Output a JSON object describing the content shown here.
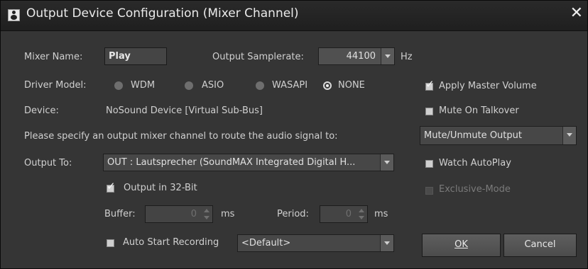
{
  "window": {
    "title": "Output Device Configuration (Mixer Channel)",
    "close_icon": "close-x-icon"
  },
  "mixer_name": {
    "label": "Mixer Name:",
    "value": "Play"
  },
  "samplerate": {
    "label": "Output Samplerate:",
    "value": "44100",
    "unit": "Hz"
  },
  "driver_model": {
    "label": "Driver Model:",
    "options": [
      "WDM",
      "ASIO",
      "WASAPI",
      "NONE"
    ],
    "selected": "NONE"
  },
  "device": {
    "label": "Device:",
    "value": "NoSound Device [Virtual Sub-Bus]"
  },
  "route_prompt": "Please specify an output mixer channel to route the audio signal to:",
  "output_to": {
    "label": "Output To:",
    "value": "OUT  : Lautsprecher (SoundMAX Integrated Digital H..."
  },
  "output_32bit": {
    "label": "Output in 32-Bit",
    "checked": true
  },
  "buffer": {
    "label": "Buffer:",
    "value": "0",
    "unit": "ms"
  },
  "period": {
    "label": "Period:",
    "value": "0",
    "unit": "ms"
  },
  "auto_start": {
    "label": "Auto Start Recording",
    "checked": false,
    "dropdown_value": "<Default>"
  },
  "apply_master_volume": {
    "label": "Apply Master Volume",
    "checked": true
  },
  "mute_on_talkover": {
    "label": "Mute On Talkover",
    "checked": false
  },
  "mute_mode": {
    "value": "Mute/Unmute Output"
  },
  "watch_autoplay": {
    "label": "Watch AutoPlay",
    "checked": false
  },
  "exclusive_mode": {
    "label": "Exclusive-Mode",
    "checked": false,
    "disabled": true
  },
  "buttons": {
    "ok": "OK",
    "cancel": "Cancel"
  }
}
